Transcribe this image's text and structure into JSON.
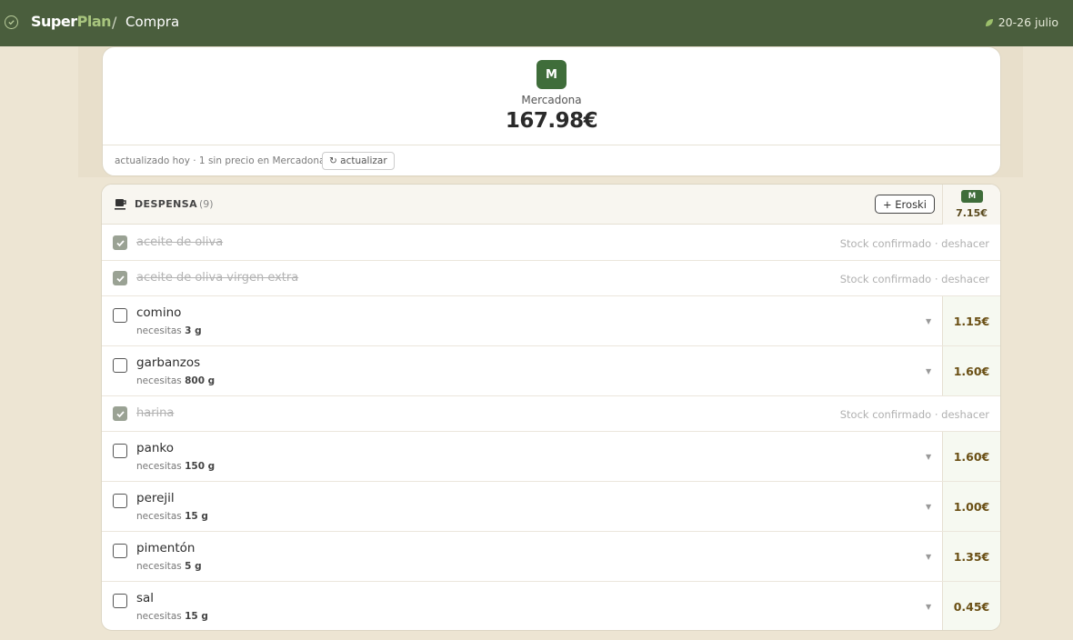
{
  "app": {
    "brand_part1": "Super",
    "brand_part2": "Plan",
    "breadcrumb_sep": "/",
    "page": "Compra",
    "week": "20-26 julio"
  },
  "summary": {
    "store_badge": "M",
    "store_name": "Mercadona",
    "total": "167.98€",
    "update_text": "actualizado hoy · 1 sin precio en Mercadona",
    "update_button": "↻ actualizar"
  },
  "section": {
    "title": "DESPENSA",
    "count": "(9)",
    "add_store_button": "+ Eroski",
    "store_badge": "M",
    "store_total": "7.15€",
    "items": [
      {
        "name": "aceite de oliva",
        "checked": true,
        "stock": "Stock confirmado · deshacer"
      },
      {
        "name": "aceite de oliva virgen extra",
        "checked": true,
        "stock": "Stock confirmado · deshacer"
      },
      {
        "name": "comino",
        "checked": false,
        "need_label": "necesitas",
        "need_qty": "3 g",
        "price": "1.15€"
      },
      {
        "name": "garbanzos",
        "checked": false,
        "need_label": "necesitas",
        "need_qty": "800 g",
        "price": "1.60€"
      },
      {
        "name": "harina",
        "checked": true,
        "stock": "Stock confirmado · deshacer"
      },
      {
        "name": "panko",
        "checked": false,
        "need_label": "necesitas",
        "need_qty": "150 g",
        "price": "1.60€"
      },
      {
        "name": "perejil",
        "checked": false,
        "need_label": "necesitas",
        "need_qty": "15 g",
        "price": "1.00€"
      },
      {
        "name": "pimentón",
        "checked": false,
        "need_label": "necesitas",
        "need_qty": "5 g",
        "price": "1.35€"
      },
      {
        "name": "sal",
        "checked": false,
        "need_label": "necesitas",
        "need_qty": "15 g",
        "price": "0.45€"
      }
    ]
  },
  "colors": {
    "topbar": "#4a5e3d",
    "brand_accent": "#a8c57e",
    "store_green": "#3f6d3a",
    "price_text": "#6a4f14",
    "background": "#ede5d3"
  },
  "icons": {
    "logo": "check-circle-icon",
    "week": "leaf-icon",
    "section": "cup-icon",
    "caret": "chevron-down-icon",
    "checked": "check-icon"
  }
}
